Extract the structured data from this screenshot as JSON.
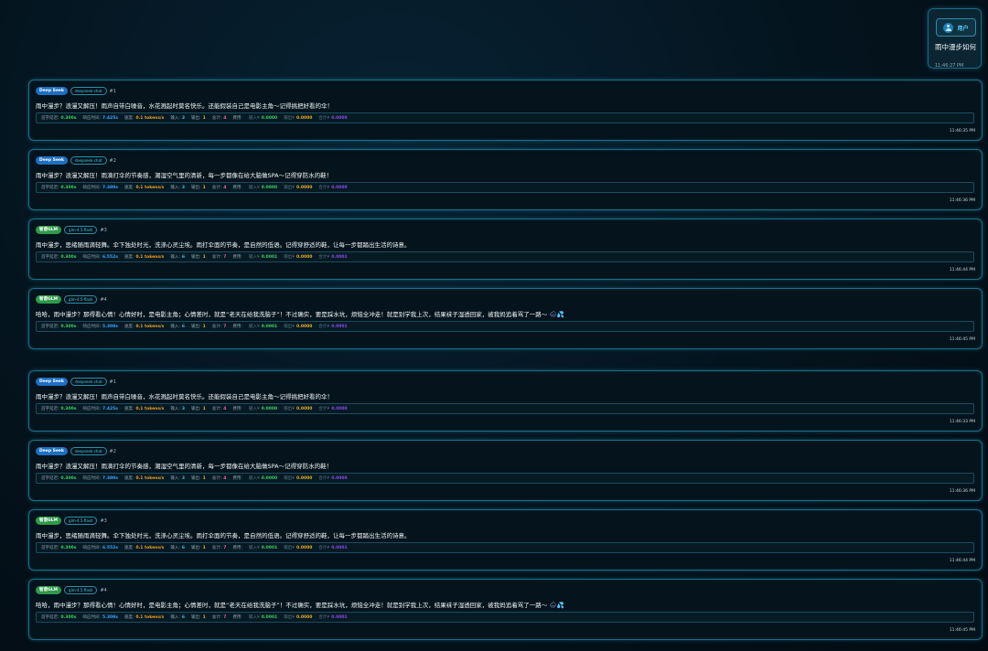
{
  "user_message": {
    "role": "用户",
    "text": "雨中漫步如何",
    "time": "11:46:27 PM",
    "icons": {
      "avatar": "user-avatar-icon"
    }
  },
  "labels": {
    "first_token": "首字延迟:",
    "response": "响应时间:",
    "speed": "速度:",
    "input": "输入:",
    "output": "输出:",
    "total": "总计:",
    "cost": "费用:",
    "cost_in": "输入¥",
    "cost_out": "输出¥",
    "cost_total": "合计¥"
  },
  "responses": [
    {
      "model": "Deep Seek",
      "tag": "deepseek-chat",
      "seq": "#1",
      "text": "雨中漫步？浪漫又解压！雨声自带白噪音，水花溅起时莫名快乐。还能假装自己是电影主角～记得挑把好看的伞！",
      "first_token": "0.300s",
      "response_time": "7.425s",
      "speed": "0.1 tokens/s",
      "input": "3",
      "output": "1",
      "total": "4",
      "cost_in": "0.0000",
      "cost_out": "0.0000",
      "cost_total": "0.0000",
      "time": "11:46:35 PM"
    },
    {
      "model": "Deep Seek",
      "tag": "deepseek-chat",
      "seq": "#2",
      "text": "雨中漫步？浪漫又解压！雨滴打伞的节奏感，潮湿空气里的清新，每一步都像在给大脑做SPA～记得穿防水的鞋！",
      "first_token": "0.300s",
      "response_time": "7.380s",
      "speed": "0.1 tokens/s",
      "input": "3",
      "output": "1",
      "total": "4",
      "cost_in": "0.0000",
      "cost_out": "0.0000",
      "cost_total": "0.0000",
      "time": "11:46:36 PM"
    },
    {
      "model": "智谱GLM",
      "tag": "glm-4.5-flash",
      "seq": "#3",
      "text": "雨中漫步，思绪随雨滴轻舞。伞下独处时光，洗涤心灵尘埃。雨打伞面的节奏，是自然的低语。记得穿舒适的鞋，让每一步都踏出生活的诗意。",
      "first_token": "0.300s",
      "response_time": "6.552s",
      "speed": "0.1 tokens/s",
      "input": "6",
      "output": "1",
      "total": "7",
      "cost_in": "0.0001",
      "cost_out": "0.0000",
      "cost_total": "0.0001",
      "time": "11:46:44 PM"
    },
    {
      "model": "智谱GLM",
      "tag": "glm-4.5-flash",
      "seq": "#4",
      "text": "哈哈，雨中漫步？那得看心情！心情好时，是电影主角；心情差时，就是“老天在给我洗脑子”！不过确实，要是踩水坑，烦恼全冲走！就是别学我上次，结果袜子湿透回家，被我妈追着骂了一路～",
      "first_token": "0.300s",
      "response_time": "5.308s",
      "speed": "0.1 tokens/s",
      "input": "6",
      "output": "1",
      "total": "7",
      "cost_in": "0.0001",
      "cost_out": "0.0000",
      "cost_total": "0.0001",
      "time": "11:46:45 PM",
      "emoji": [
        "🌧",
        "💦"
      ]
    },
    {
      "model": "Deep Seek",
      "tag": "deepseek-chat",
      "seq": "#1",
      "text": "雨中漫步？浪漫又解压！雨声自带白噪音，水花溅起时莫名快乐。还能假装自己是电影主角～记得挑把好看的伞！",
      "first_token": "0.300s",
      "response_time": "7.425s",
      "speed": "0.1 tokens/s",
      "input": "3",
      "output": "1",
      "total": "4",
      "cost_in": "0.0000",
      "cost_out": "0.0000",
      "cost_total": "0.0000",
      "time": "11:46:33 PM"
    },
    {
      "model": "Deep Seek",
      "tag": "deepseek-chat",
      "seq": "#2",
      "text": "雨中漫步？浪漫又解压！雨滴打伞的节奏感，潮湿空气里的清新，每一步都像在给大脑做SPA～记得穿防水的鞋！",
      "first_token": "0.300s",
      "response_time": "7.380s",
      "speed": "0.1 tokens/s",
      "input": "3",
      "output": "1",
      "total": "4",
      "cost_in": "0.0000",
      "cost_out": "0.0000",
      "cost_total": "0.0000",
      "time": "11:46:36 PM"
    },
    {
      "model": "智谱GLM",
      "tag": "glm-4.5-flash",
      "seq": "#3",
      "text": "雨中漫步，思绪随雨滴轻舞。伞下独处时光，洗涤心灵尘埃。雨打伞面的节奏，是自然的低语。记得穿舒适的鞋，让每一步都踏出生活的诗意。",
      "first_token": "0.300s",
      "response_time": "6.552s",
      "speed": "0.1 tokens/s",
      "input": "6",
      "output": "1",
      "total": "7",
      "cost_in": "0.0001",
      "cost_out": "0.0000",
      "cost_total": "0.0001",
      "time": "11:46:44 PM"
    },
    {
      "model": "智谱GLM",
      "tag": "glm-4.5-flash",
      "seq": "#4",
      "text": "哈哈，雨中漫步？那得看心情！心情好时，是电影主角；心情差时，就是“老天在给我洗脑子”！不过确实，要是踩水坑，烦恼全冲走！就是别学我上次，结果袜子湿透回家，被我妈追着骂了一路～",
      "first_token": "0.300s",
      "response_time": "5.308s",
      "speed": "0.1 tokens/s",
      "input": "6",
      "output": "1",
      "total": "7",
      "cost_in": "0.0001",
      "cost_out": "0.0000",
      "cost_total": "0.0001",
      "time": "11:46:45 PM",
      "emoji": [
        "🌧",
        "💦"
      ]
    }
  ]
}
